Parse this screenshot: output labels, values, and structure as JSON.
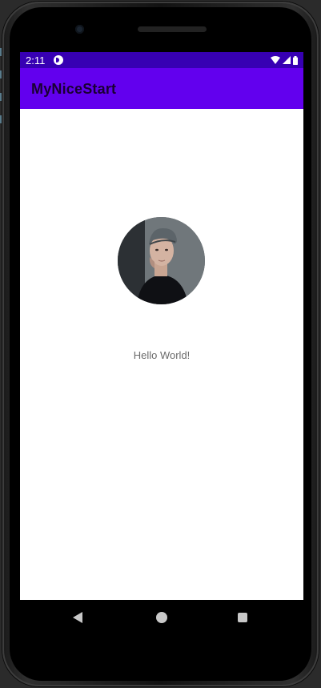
{
  "status_bar": {
    "time": "2:11",
    "background_color": "#3700b3",
    "notification_icon": "notification-icon",
    "wifi_icon": "wifi-icon",
    "signal_icon": "signal-icon",
    "battery_icon": "battery-icon"
  },
  "app_bar": {
    "title": "MyNiceStart",
    "background_color": "#6200ee"
  },
  "content": {
    "avatar_icon": "profile-photo",
    "greeting": "Hello World!"
  },
  "nav_bar": {
    "back_icon": "back-icon",
    "home_icon": "home-icon",
    "recents_icon": "recents-icon"
  }
}
